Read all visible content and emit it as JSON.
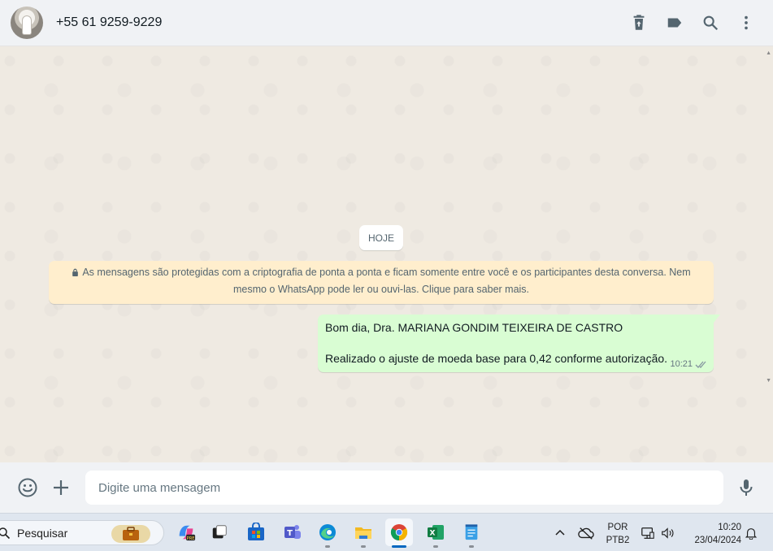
{
  "header": {
    "contact_name": "+55 61 9259-9229",
    "actions": [
      "delete-chat-icon",
      "label-icon",
      "search-icon",
      "menu-icon"
    ]
  },
  "chat": {
    "day_label": "HOJE",
    "encryption_notice": "As mensagens são protegidas com a criptografia de ponta a ponta e ficam somente entre você e os participantes desta conversa. Nem mesmo o WhatsApp pode ler ou ouvi-las. Clique para saber mais.",
    "messages": [
      {
        "line1": "Bom dia, Dra. MARIANA GONDIM TEIXEIRA DE CASTRO",
        "line2": "Realizado o ajuste de moeda base para 0,42 conforme autorização.",
        "time": "10:21",
        "status": "delivered"
      }
    ]
  },
  "composer": {
    "placeholder": "Digite uma mensagem"
  },
  "taskbar": {
    "search_placeholder": "Pesquisar",
    "apps": [
      "briefcase",
      "copilot",
      "task-view",
      "microsoft-store",
      "teams",
      "edge",
      "file-explorer",
      "chrome",
      "excel",
      "notepad"
    ],
    "active_app": "chrome",
    "language_line1": "POR",
    "language_line2": "PTB2",
    "time": "10:20",
    "date": "23/04/2024"
  },
  "colors": {
    "header_bg": "#f0f2f5",
    "chat_bg": "#efeae2",
    "outgoing_bubble": "#d9fdd3",
    "notice_bg": "#ffeecd",
    "taskbar_bg": "#dfe6ef"
  }
}
